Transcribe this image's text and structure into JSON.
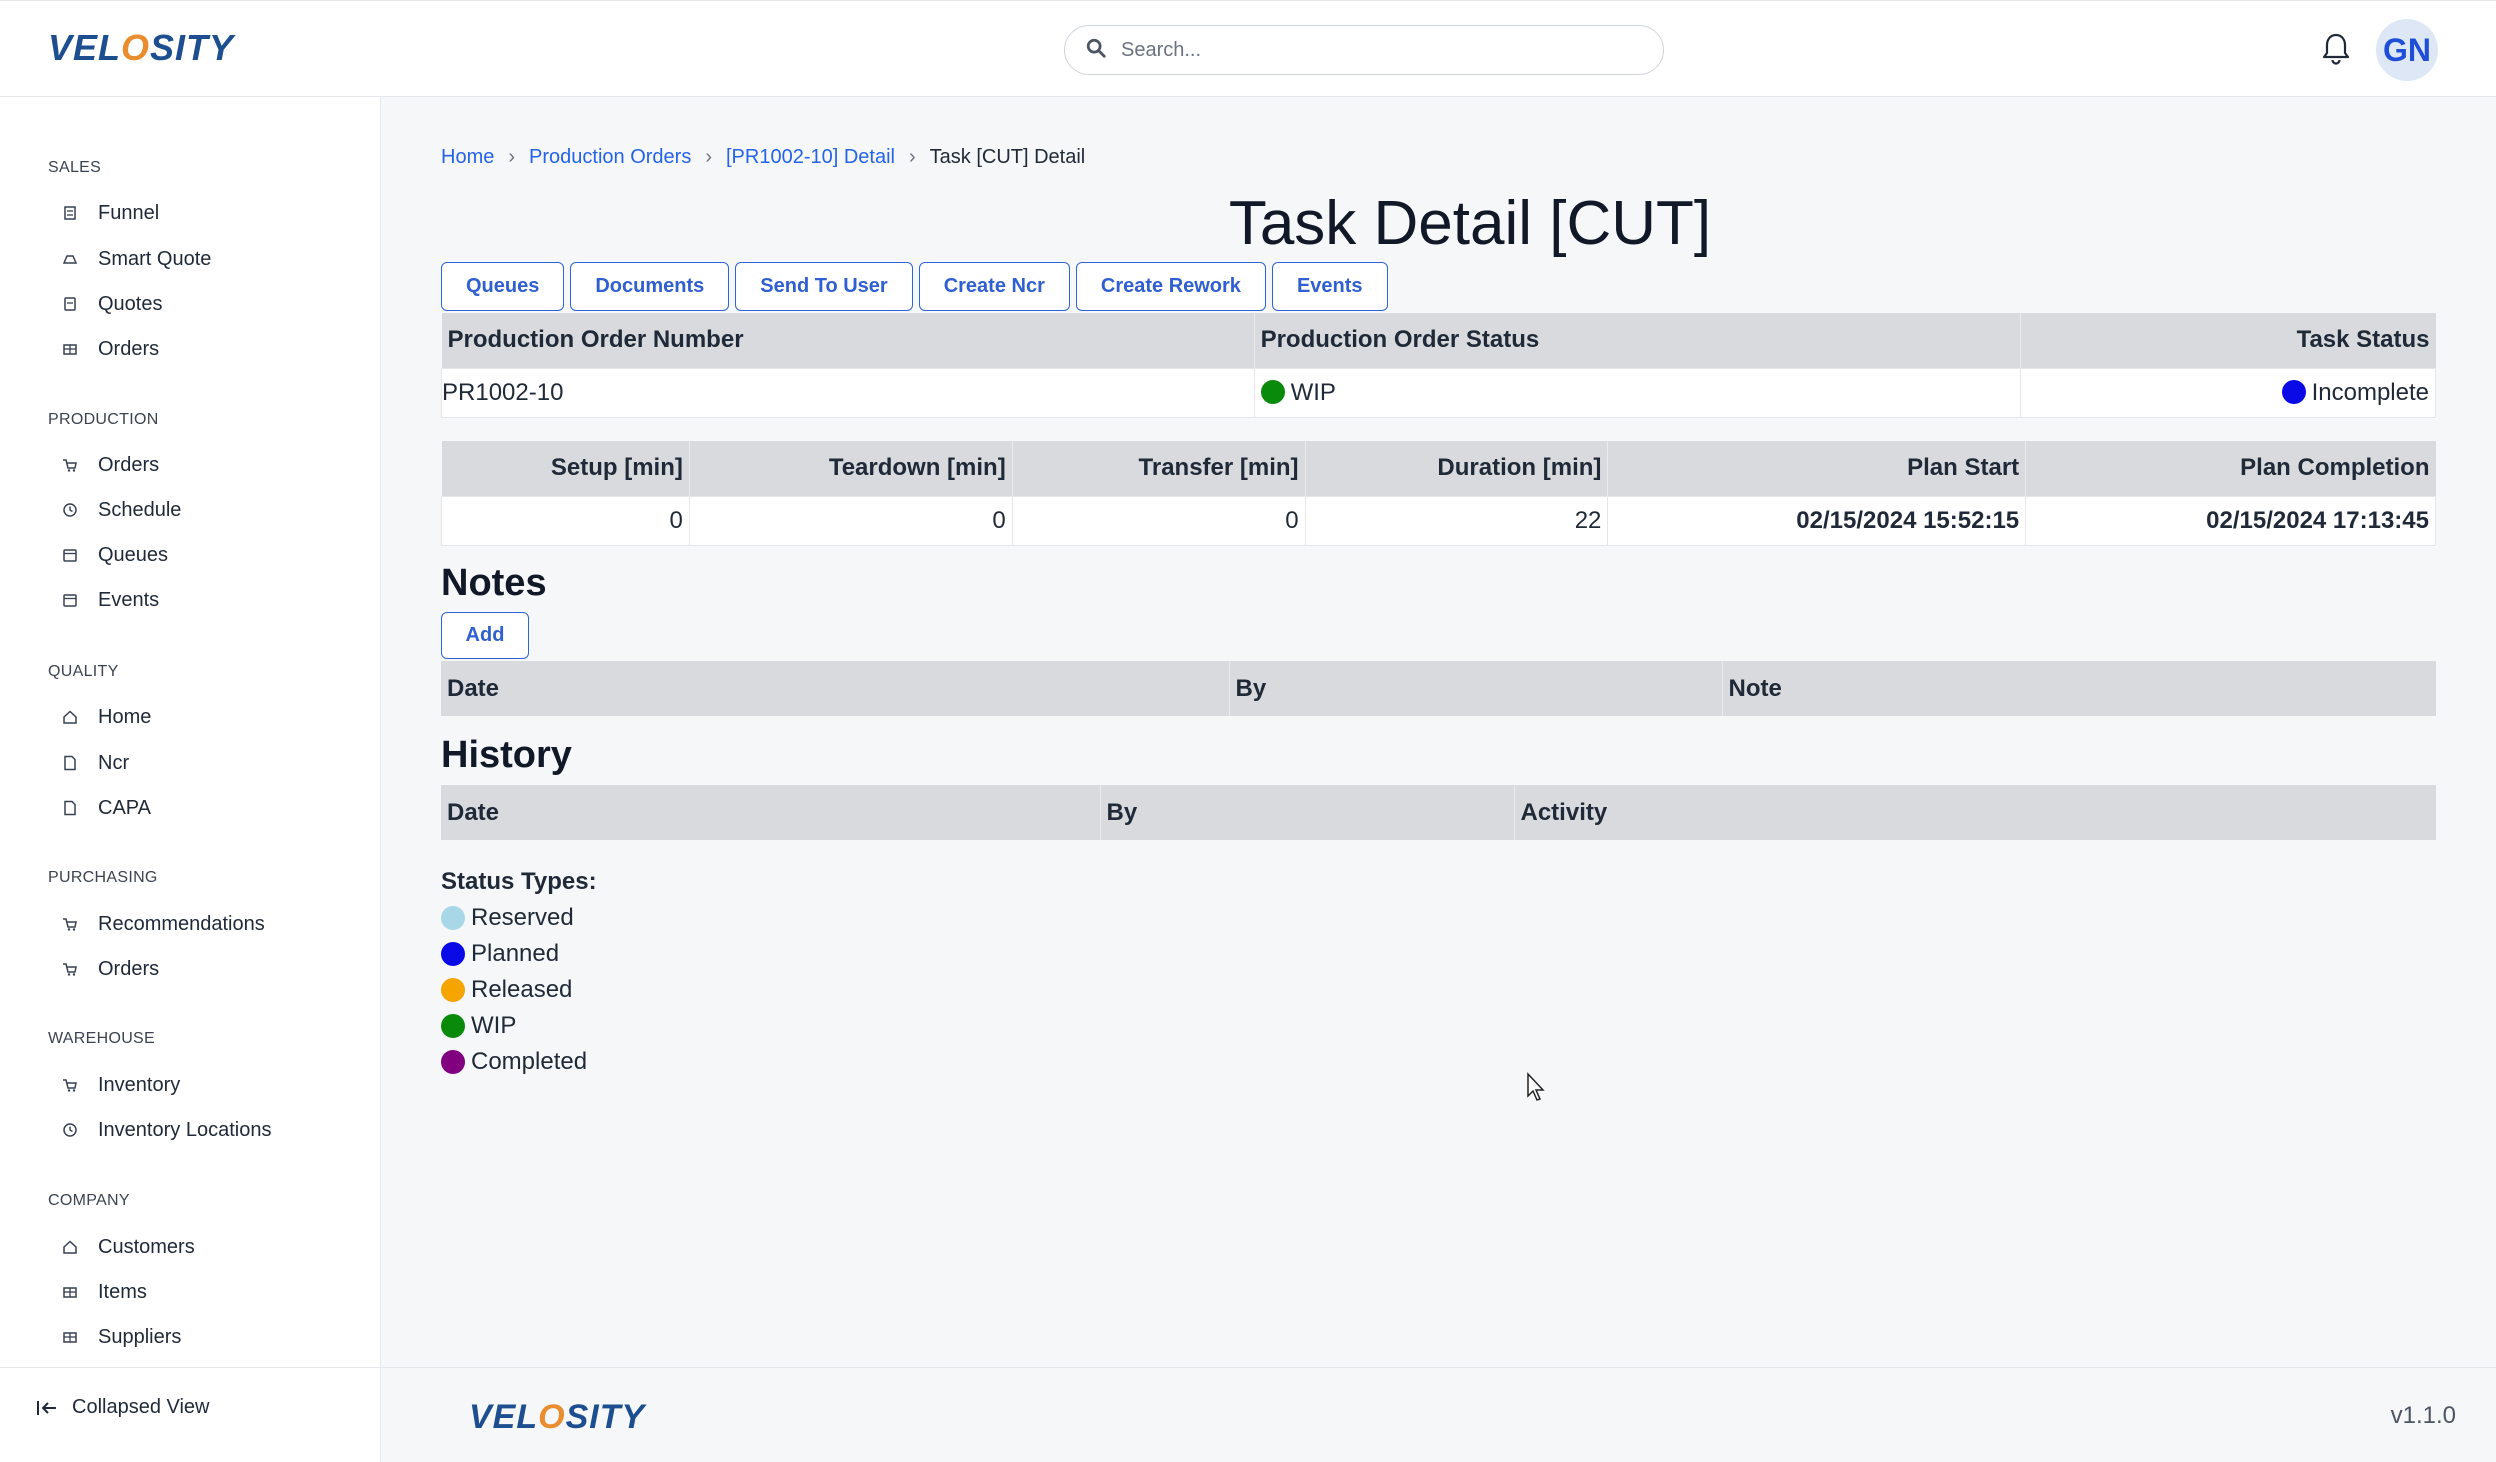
{
  "brand": {
    "logo_text": "VELOSITY"
  },
  "search": {
    "placeholder": "Search..."
  },
  "user": {
    "initials": "GN"
  },
  "sidebar": {
    "sections": [
      {
        "title": "SALES",
        "items": [
          {
            "label": "Funnel",
            "icon": "funnel-icon"
          },
          {
            "label": "Smart Quote",
            "icon": "quote-icon"
          },
          {
            "label": "Quotes",
            "icon": "document-icon"
          },
          {
            "label": "Orders",
            "icon": "orders-icon"
          }
        ]
      },
      {
        "title": "PRODUCTION",
        "items": [
          {
            "label": "Orders",
            "icon": "cart-icon"
          },
          {
            "label": "Schedule",
            "icon": "clock-icon"
          },
          {
            "label": "Queues",
            "icon": "calendar-icon"
          },
          {
            "label": "Events",
            "icon": "calendar-icon"
          }
        ]
      },
      {
        "title": "QUALITY",
        "items": [
          {
            "label": "Home",
            "icon": "home-icon"
          },
          {
            "label": "Ncr",
            "icon": "file-icon"
          },
          {
            "label": "CAPA",
            "icon": "file-icon"
          }
        ]
      },
      {
        "title": "PURCHASING",
        "items": [
          {
            "label": "Recommendations",
            "icon": "cart-icon"
          },
          {
            "label": "Orders",
            "icon": "cart-icon"
          }
        ]
      },
      {
        "title": "WAREHOUSE",
        "items": [
          {
            "label": "Inventory",
            "icon": "cart-icon"
          },
          {
            "label": "Inventory Locations",
            "icon": "clock-icon"
          }
        ]
      },
      {
        "title": "COMPANY",
        "items": [
          {
            "label": "Customers",
            "icon": "home-icon"
          },
          {
            "label": "Items",
            "icon": "orders-icon"
          },
          {
            "label": "Suppliers",
            "icon": "orders-icon"
          }
        ]
      }
    ],
    "collapse_label": "Collapsed View"
  },
  "breadcrumb": {
    "home": "Home",
    "production_orders": "Production Orders",
    "detail": "[PR1002-10] Detail",
    "current": "Task [CUT] Detail"
  },
  "page": {
    "title": "Task Detail [CUT]"
  },
  "actions": {
    "queues": "Queues",
    "documents": "Documents",
    "send_to_user": "Send To User",
    "create_ncr": "Create Ncr",
    "create_rework": "Create Rework",
    "events": "Events"
  },
  "order_table": {
    "headers": [
      "Production Order Number",
      "Production Order Status",
      "Task Status"
    ],
    "row": {
      "number": "PR1002-10",
      "status": "WIP",
      "status_color": "#0a8a0a",
      "task_status": "Incomplete",
      "task_status_color": "#0a0ae6"
    }
  },
  "timing_table": {
    "headers": [
      "Setup [min]",
      "Teardown [min]",
      "Transfer [min]",
      "Duration [min]",
      "Plan Start",
      "Plan Completion"
    ],
    "row": [
      "0",
      "0",
      "0",
      "22",
      "02/15/2024 15:52:15",
      "02/15/2024 17:13:45"
    ]
  },
  "notes": {
    "title": "Notes",
    "add_label": "Add",
    "headers": [
      "Date",
      "By",
      "Note"
    ]
  },
  "history": {
    "title": "History",
    "headers": [
      "Date",
      "By",
      "Activity"
    ]
  },
  "status_types": {
    "title": "Status Types:",
    "items": [
      {
        "label": "Reserved",
        "color": "#a8d8e8"
      },
      {
        "label": "Planned",
        "color": "#0a0ae6"
      },
      {
        "label": "Released",
        "color": "#f5a400"
      },
      {
        "label": "WIP",
        "color": "#0a8a0a"
      },
      {
        "label": "Completed",
        "color": "#800080"
      }
    ]
  },
  "footer": {
    "version": "v1.1.0"
  }
}
